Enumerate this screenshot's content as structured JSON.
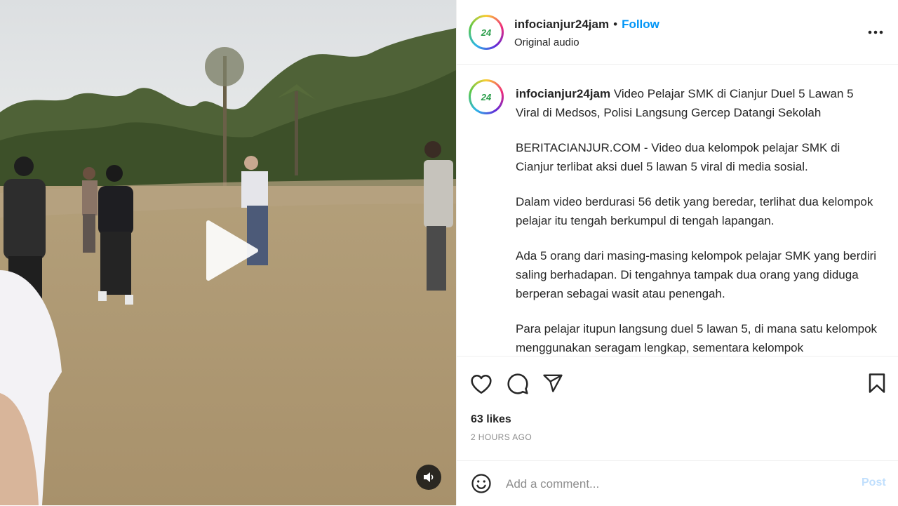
{
  "post": {
    "username": "infocianjur24jam",
    "separator": "•",
    "follow_label": "Follow",
    "audio_label": "Original audio",
    "more_icon": "more-horizontal-icon",
    "avatar_text": "24"
  },
  "caption": {
    "username": "infocianjur24jam",
    "title": "Video Pelajar SMK di Cianjur Duel 5 Lawan 5 Viral di Medsos, Polisi Langsung Gercep Datangi Sekolah",
    "paragraphs": [
      "BERITACIANJUR.COM - Video dua kelompok pelajar SMK di Cianjur terlibat aksi duel 5 lawan 5 viral di media sosial.",
      "Dalam video berdurasi 56 detik yang beredar, terlihat dua kelompok pelajar itu tengah berkumpul di tengah lapangan.",
      "Ada 5 orang dari masing-masing kelompok pelajar SMK yang berdiri saling berhadapan. Di tengahnya tampak dua orang yang diduga berperan sebagai wasit atau penengah.",
      "Para pelajar itupun langsung duel 5 lawan 5, di mana satu kelompok menggunakan seragam lengkap, sementara kelompok"
    ]
  },
  "actions": {
    "icons": [
      "heart-icon",
      "comment-icon",
      "share-icon",
      "bookmark-icon"
    ],
    "likes": "63 likes",
    "time": "2 HOURS AGO"
  },
  "comment": {
    "placeholder": "Add a comment...",
    "post_label": "Post",
    "emoji_icon": "emoji-icon"
  },
  "video": {
    "play_icon": "play-icon",
    "mute_icon": "speaker-icon"
  },
  "colors": {
    "accent": "#0095f6",
    "post_disabled": "#c0dffd",
    "text": "#262626",
    "muted": "#8e8e8e"
  }
}
